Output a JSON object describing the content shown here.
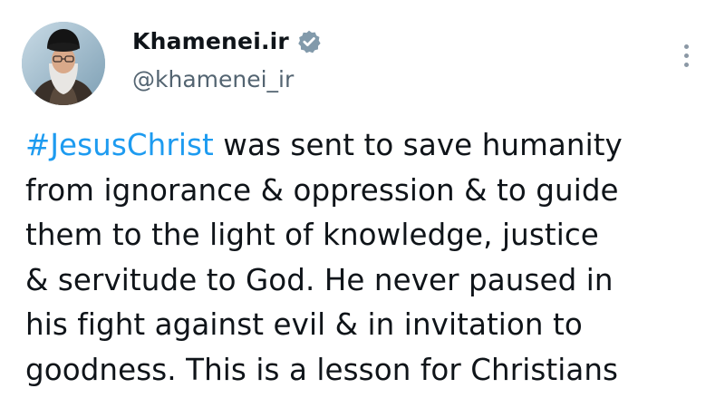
{
  "author": {
    "display_name": "Khamenei.ir",
    "handle": "@khamenei_ir",
    "verified_icon": "verified-badge-icon",
    "avatar": "profile-photo"
  },
  "more_button_icon": "more-options-icon",
  "tweet": {
    "hashtag": "#JesusChrist",
    "lines": [
      " was sent to save humanity",
      "from ignorance & oppression & to guide",
      "them to the light of knowledge, justice",
      "& servitude to God. He never paused in",
      "his fight against evil & in invitation to",
      "goodness. This is a lesson for Christians"
    ]
  },
  "colors": {
    "link": "#1d9bf0",
    "text": "#0f1419",
    "secondary": "#536471",
    "verified": "#829aab"
  }
}
